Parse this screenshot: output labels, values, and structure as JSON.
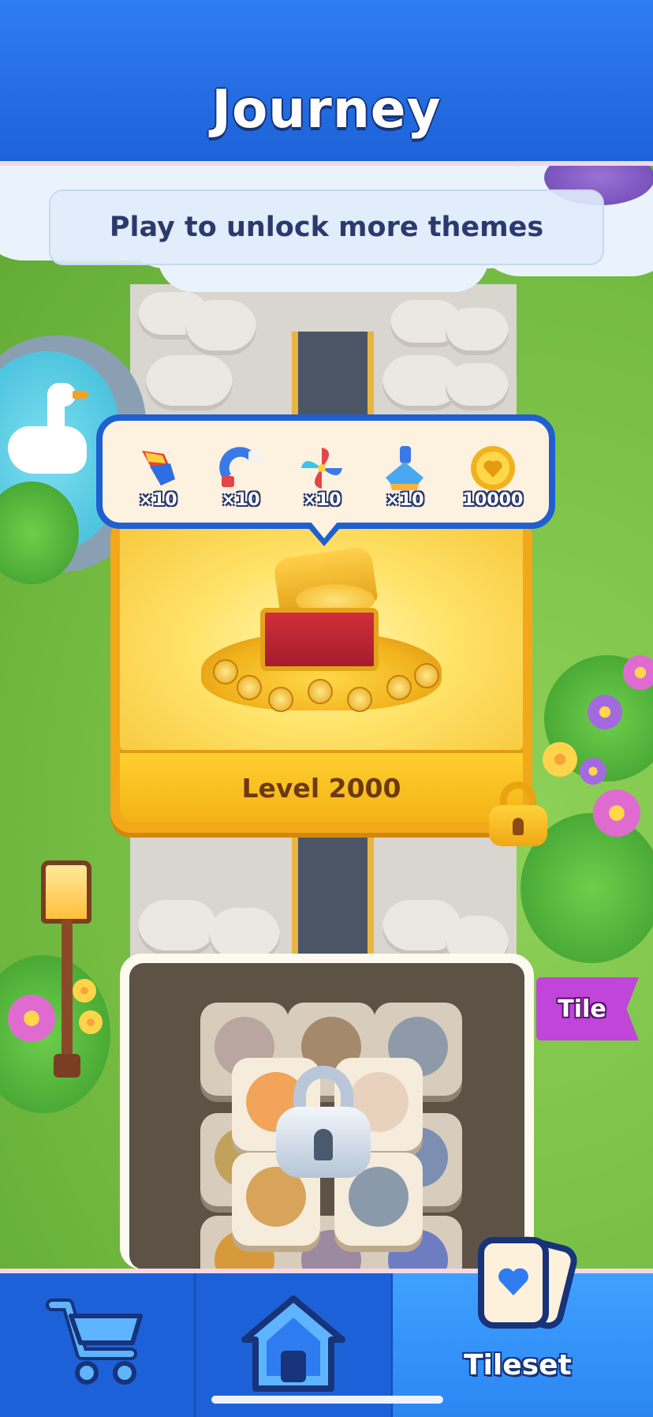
{
  "header": {
    "title": "Journey"
  },
  "banner": {
    "text": "Play to unlock more themes"
  },
  "rewards": [
    {
      "icon": "firework-rocket-icon",
      "count": "×10"
    },
    {
      "icon": "magnet-icon",
      "count": "×10"
    },
    {
      "icon": "pinwheel-icon",
      "count": "×10"
    },
    {
      "icon": "brush-icon",
      "count": "×10"
    },
    {
      "icon": "coin-icon",
      "count": "10000"
    }
  ],
  "level_card": {
    "label": "Level 2000",
    "locked": true
  },
  "tileset_card": {
    "tag": "Tile",
    "locked": true
  },
  "bottom_nav": {
    "items": [
      {
        "icon": "shopping-cart-icon",
        "label": ""
      },
      {
        "icon": "home-icon",
        "label": ""
      },
      {
        "icon": "tileset-cards-icon",
        "label": "Tileset",
        "active": true
      }
    ]
  },
  "colors": {
    "header_blue": "#1d62d8",
    "accent_gold": "#f2a818",
    "tag_purple": "#c045d8",
    "tooltip_border": "#1e5fd1"
  }
}
